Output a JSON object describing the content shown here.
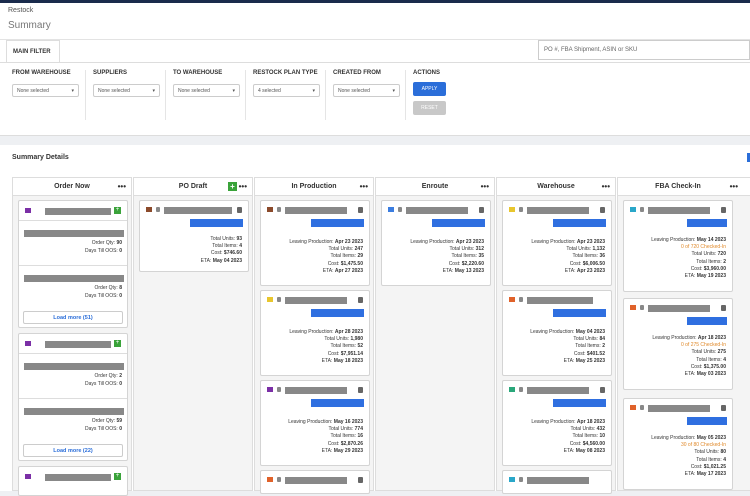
{
  "app": {
    "breadcrumb": "Restock",
    "title": "Summary"
  },
  "filter": {
    "tab": "MAIN FILTER",
    "search_placeholder": "PO #, FBA Shipment, ASIN or SKU",
    "fields": [
      {
        "label": "FROM WAREHOUSE",
        "value": "None selected"
      },
      {
        "label": "SUPPLIERS",
        "value": "None selected"
      },
      {
        "label": "TO WAREHOUSE",
        "value": "None selected"
      },
      {
        "label": "RESTOCK PLAN TYPE",
        "value": "4 selected"
      },
      {
        "label": "CREATED FROM",
        "value": "None selected"
      }
    ],
    "actions_label": "ACTIONS",
    "apply": "APPLY",
    "reset": "RESET"
  },
  "summary": {
    "title": "Summary Details"
  },
  "columns": [
    {
      "title": "Order Now",
      "menu": "•••"
    },
    {
      "title": "PO Draft",
      "menu": "•••"
    },
    {
      "title": "In Production",
      "menu": "•••"
    },
    {
      "title": "Enroute",
      "menu": "•••"
    },
    {
      "title": "Warehouse",
      "menu": "•••"
    },
    {
      "title": "FBA Check-In",
      "menu": "•••"
    }
  ],
  "order_now": {
    "groups": [
      {
        "items": [
          {
            "qty_label": "Order Qty:",
            "qty": "90",
            "days_label": "Days Till OOS:",
            "days": "0"
          },
          {
            "qty_label": "Order Qty:",
            "qty": "8",
            "days_label": "Days Till OOS:",
            "days": "0"
          }
        ],
        "load_more": "Load more (51)"
      },
      {
        "items": [
          {
            "qty_label": "Order Qty:",
            "qty": "2",
            "days_label": "Days Till OOS:",
            "days": "0"
          },
          {
            "qty_label": "Order Qty:",
            "qty": "59",
            "days_label": "Days Till OOS:",
            "days": "0"
          }
        ],
        "load_more": "Load more (22)"
      }
    ]
  },
  "po_draft": [
    {
      "units": "93",
      "items": "4",
      "cost": "$746.60",
      "eta": "May 04 2023"
    }
  ],
  "in_production": [
    {
      "leaving": "Apr 23 2023",
      "units": "247",
      "items": "29",
      "cost": "$1,475.50",
      "eta": "Apr 27 2023"
    },
    {
      "leaving": "Apr 28 2023",
      "units": "1,980",
      "items": "52",
      "cost": "$7,951.14",
      "eta": "May 18 2023"
    },
    {
      "leaving": "May 16 2023",
      "units": "774",
      "items": "16",
      "cost": "$2,870.26",
      "eta": "May 29 2023"
    }
  ],
  "enroute": [
    {
      "leaving": "Apr 23 2023",
      "units": "312",
      "items": "35",
      "cost": "$2,220.60",
      "eta": "May 13 2023"
    }
  ],
  "warehouse": [
    {
      "leaving": "Apr 23 2023",
      "units": "1,132",
      "items": "36",
      "cost": "$6,006.50",
      "eta": "Apr 23 2023"
    },
    {
      "leaving": "May 04 2023",
      "units": "84",
      "items": "2",
      "cost": "$401.52",
      "eta": "May 25 2023"
    },
    {
      "leaving": "Apr 18 2023",
      "units": "432",
      "items": "10",
      "cost": "$4,560.00",
      "eta": "May 08 2023"
    }
  ],
  "fba": [
    {
      "leaving": "May 14 2023",
      "checked": "0 of 720 Checked-In",
      "units": "720",
      "items": "2",
      "cost": "$3,960.00",
      "eta": "May 19 2023"
    },
    {
      "leaving": "Apr 18 2023",
      "checked": "0 of 275 Checked-In",
      "units": "275",
      "items": "4",
      "cost": "$1,375.00",
      "eta": "May 03 2023"
    },
    {
      "leaving": "May 05 2023",
      "checked": "30 of 80 Checked-In",
      "units": "80",
      "items": "4",
      "cost": "$1,021.25",
      "eta": "May 17 2023"
    }
  ],
  "labels": {
    "leaving": "Leaving Production:",
    "units": "Total Units:",
    "items": "Total Items:",
    "cost": "Cost:",
    "eta": "ETA:"
  },
  "colors": {
    "accent": "#2b6ed9",
    "green": "#3aa33a",
    "orange": "#e0892a",
    "icon_colors": [
      "#7b2fa6",
      "#8b4a2b",
      "#e8c62e",
      "#3b7de0",
      "#e0622a",
      "#2aa7c9"
    ]
  }
}
